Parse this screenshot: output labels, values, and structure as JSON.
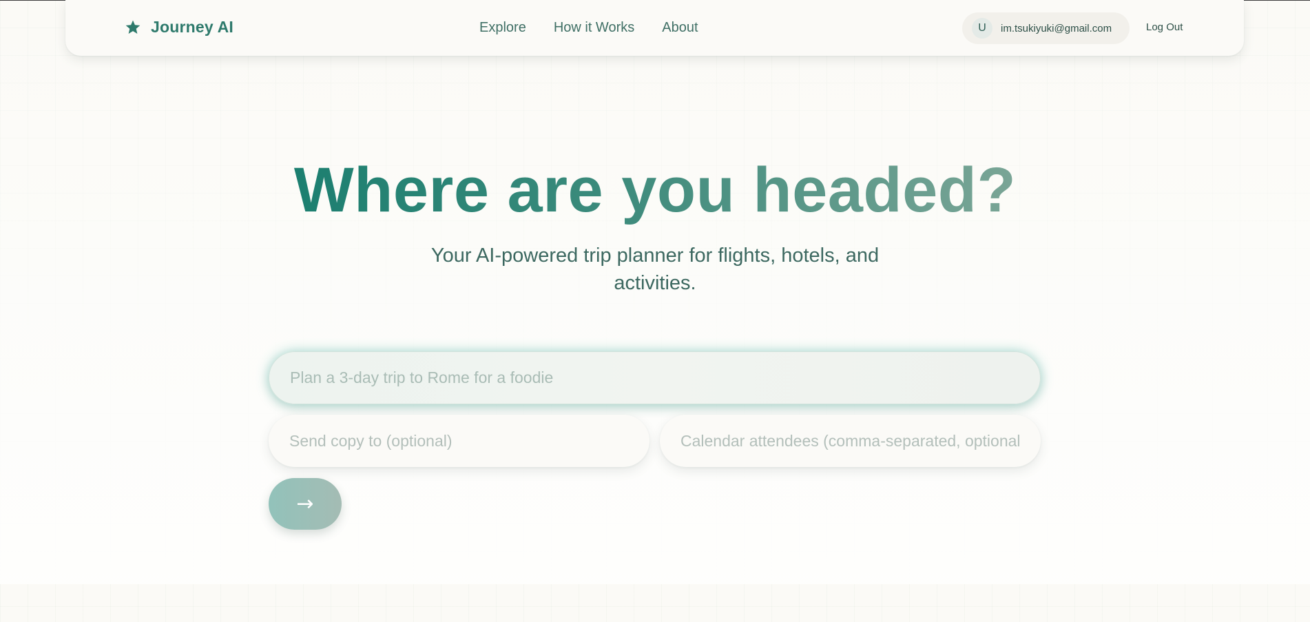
{
  "app": {
    "brand_name": "Journey AI",
    "brand_icon": "star-icon",
    "accent_color": "#2e7a6c"
  },
  "nav": {
    "links": [
      {
        "label": "Explore"
      },
      {
        "label": "How it Works"
      },
      {
        "label": "About"
      }
    ]
  },
  "user": {
    "avatar_initial": "U",
    "email": "im.tsukiyuki@gmail.com",
    "logout_label": "Log Out"
  },
  "hero": {
    "headline": "Where are you headed?",
    "subtitle": "Your AI-powered trip planner for flights, hotels, and activities."
  },
  "form": {
    "prompt_placeholder": "Plan a 3-day trip to Rome for a foodie",
    "prompt_value": "",
    "send_copy_placeholder": "Send copy to (optional)",
    "send_copy_value": "",
    "attendees_placeholder": "Calendar attendees (comma-separated, optional)",
    "attendees_value": "",
    "submit_icon": "arrow-right-icon",
    "submit_glyph": "→"
  }
}
